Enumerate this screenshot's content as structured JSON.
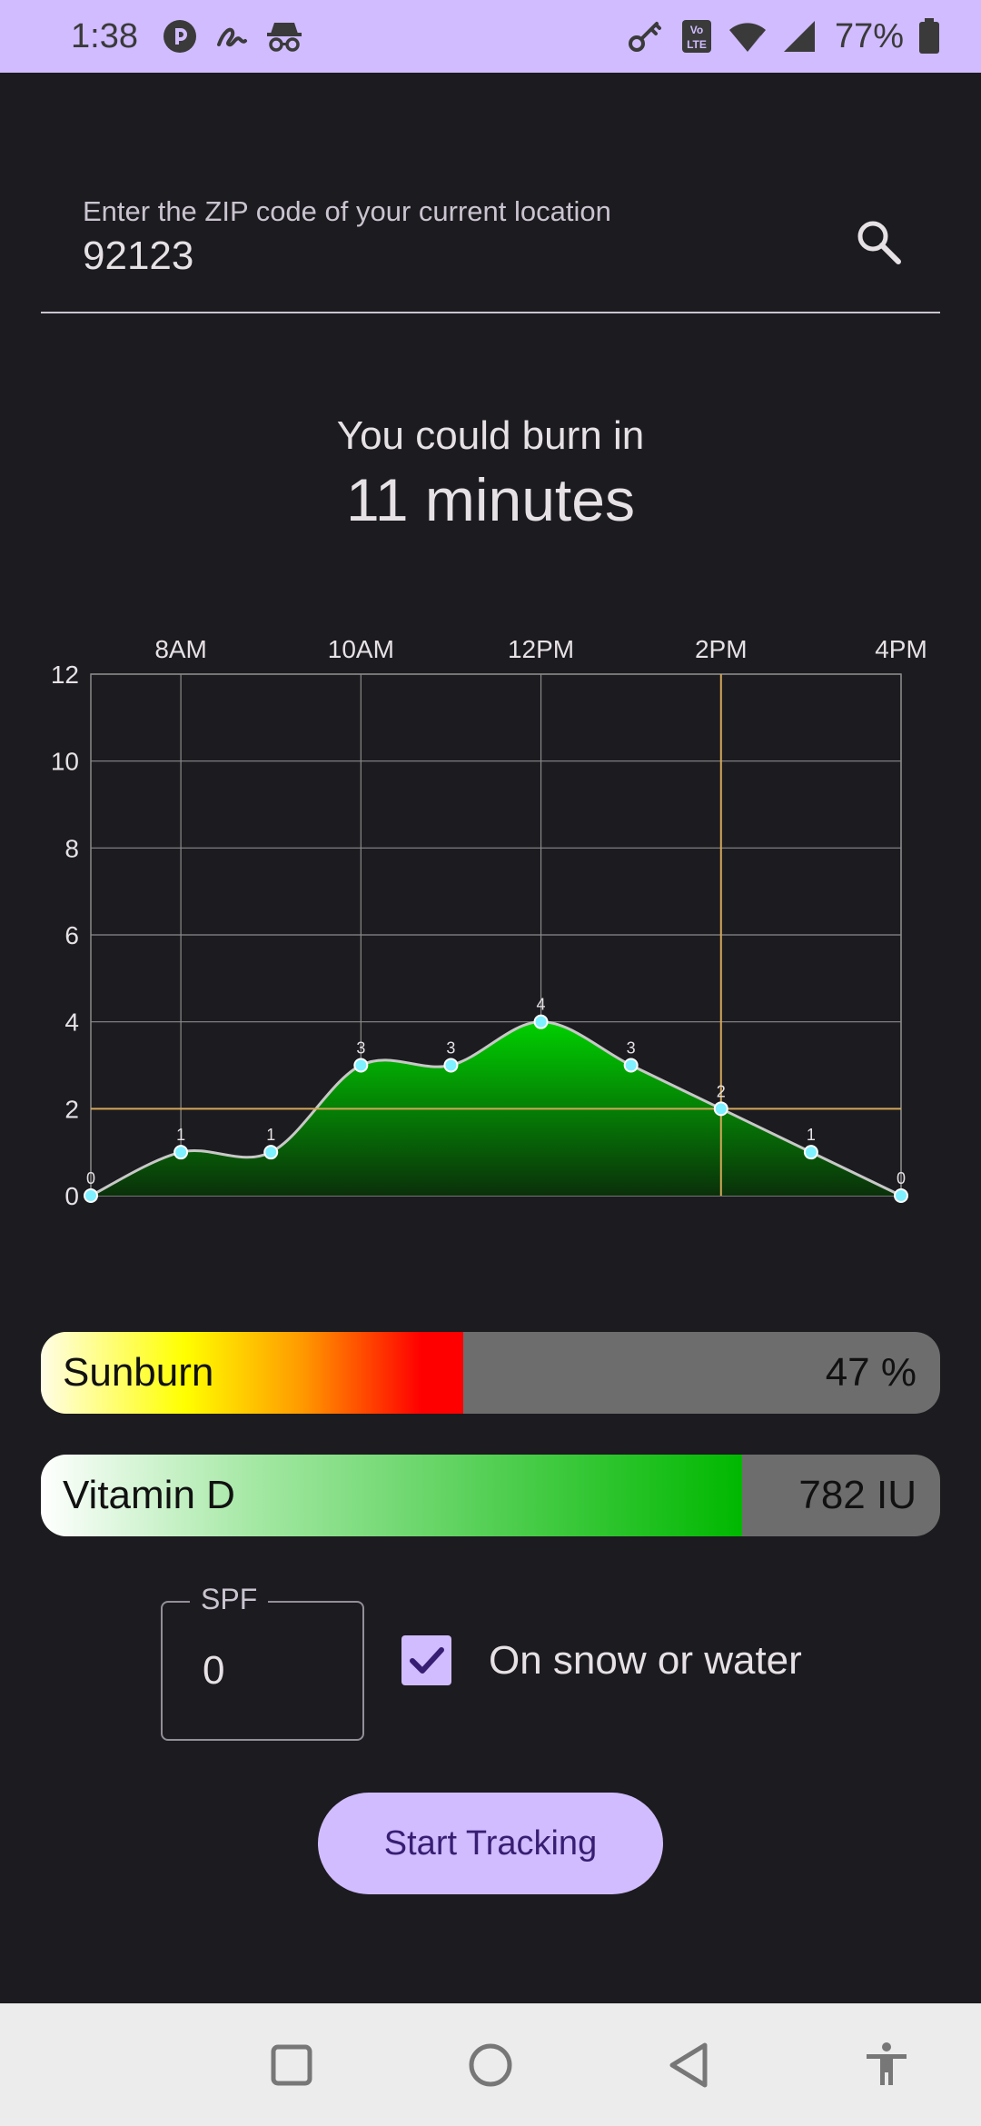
{
  "status_bar": {
    "time": "1:38",
    "battery": "77%",
    "icons_left": [
      "dnd-circle-icon",
      "signature-icon",
      "incognito-icon"
    ],
    "icons_right": [
      "vpn-key-icon",
      "volte-icon",
      "wifi-icon",
      "cell-signal-icon",
      "battery-icon"
    ],
    "volte_text": "Vo LTE"
  },
  "zip": {
    "label": "Enter the ZIP code of your current location",
    "value": "92123"
  },
  "burn": {
    "line1": "You could burn in",
    "line2": "11 minutes"
  },
  "chart_data": {
    "type": "area",
    "x": [
      "7AM",
      "8AM",
      "9AM",
      "10AM",
      "11AM",
      "12PM",
      "1PM",
      "2PM",
      "3PM",
      "4PM"
    ],
    "x_tick_labels": [
      "8AM",
      "10AM",
      "12PM",
      "2PM",
      "4PM"
    ],
    "values": [
      0,
      1,
      1,
      3,
      3,
      4,
      3,
      2,
      1,
      0
    ],
    "y_tick_labels": [
      "0",
      "2",
      "4",
      "6",
      "8",
      "10",
      "12"
    ],
    "ylim": [
      0,
      12
    ],
    "crosshair": {
      "x": "2PM",
      "y": 2
    },
    "grid": true,
    "fill_color_top": "#00d000",
    "fill_color_bottom": "#0a300a",
    "line_color": "#c8c8c8",
    "point_color": "#7ff0ff",
    "crosshair_color": "#d4a85a"
  },
  "sunburn": {
    "label": "Sunburn",
    "value_text": "47 %",
    "fraction": 0.47
  },
  "vitamin_d": {
    "label": "Vitamin D",
    "value_text": "782 IU",
    "fraction": 0.78
  },
  "spf": {
    "label": "SPF",
    "value": "0"
  },
  "snow_water": {
    "label": "On snow or water",
    "checked": true
  },
  "start_button": {
    "label": "Start Tracking"
  },
  "nav": [
    "recents-icon",
    "home-icon",
    "back-icon",
    "accessibility-icon"
  ],
  "colors": {
    "accent": "#d0bcff",
    "background": "#1c1b1f"
  }
}
